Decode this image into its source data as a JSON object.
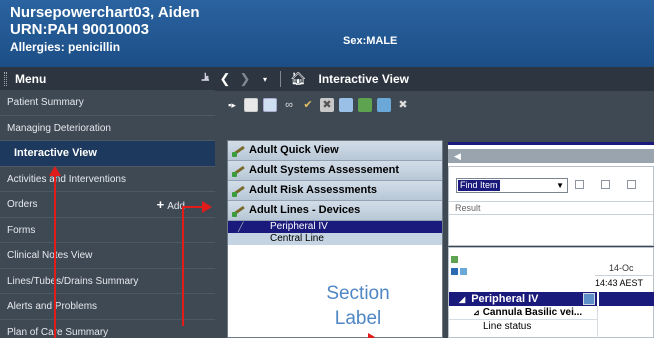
{
  "patient": {
    "name": "Nursepowerchart03, Aiden",
    "urn": "URN:PAH 90010003",
    "allergies": "Allergies: penicillin",
    "sex": "Sex:MALE"
  },
  "menu": {
    "title": "Menu",
    "items": [
      {
        "label": "Patient Summary"
      },
      {
        "label": "Managing Deterioration"
      },
      {
        "label": "Interactive View",
        "active": true
      },
      {
        "label": "Activities and Interventions"
      },
      {
        "label": "Orders",
        "action": "Add"
      },
      {
        "label": "Forms"
      },
      {
        "label": "Clinical Notes View"
      },
      {
        "label": "Lines/Tubes/Drains Summary"
      },
      {
        "label": "Alerts and Problems"
      },
      {
        "label": "Plan of Care Summary"
      }
    ]
  },
  "navbar": {
    "title": "Interactive View"
  },
  "bands": [
    {
      "label": "Adult Quick View"
    },
    {
      "label": "Adult Systems Assessement"
    },
    {
      "label": "Adult Risk Assessments"
    },
    {
      "label": "Adult Lines - Devices"
    }
  ],
  "sub_items": [
    {
      "label": "Peripheral IV",
      "selected": true
    },
    {
      "label": "Central Line",
      "selected": false
    }
  ],
  "annotation": {
    "section_label_line1": "Section",
    "section_label_line2": "Label"
  },
  "find": {
    "select_value": "Find Item",
    "result_label": "Result"
  },
  "grid": {
    "date_header": "14-Oc",
    "time_header": "14:43 AEST",
    "section_row": "Peripheral IV",
    "group_row": "Cannula Basilic vei...",
    "item_row": "Line status"
  },
  "colors": {
    "banner": "#1f5590",
    "menu_bg": "#3f4954",
    "selection": "#1a1a7c",
    "annotation_red": "#e21b1b",
    "section_label_blue": "#4f86c4"
  }
}
